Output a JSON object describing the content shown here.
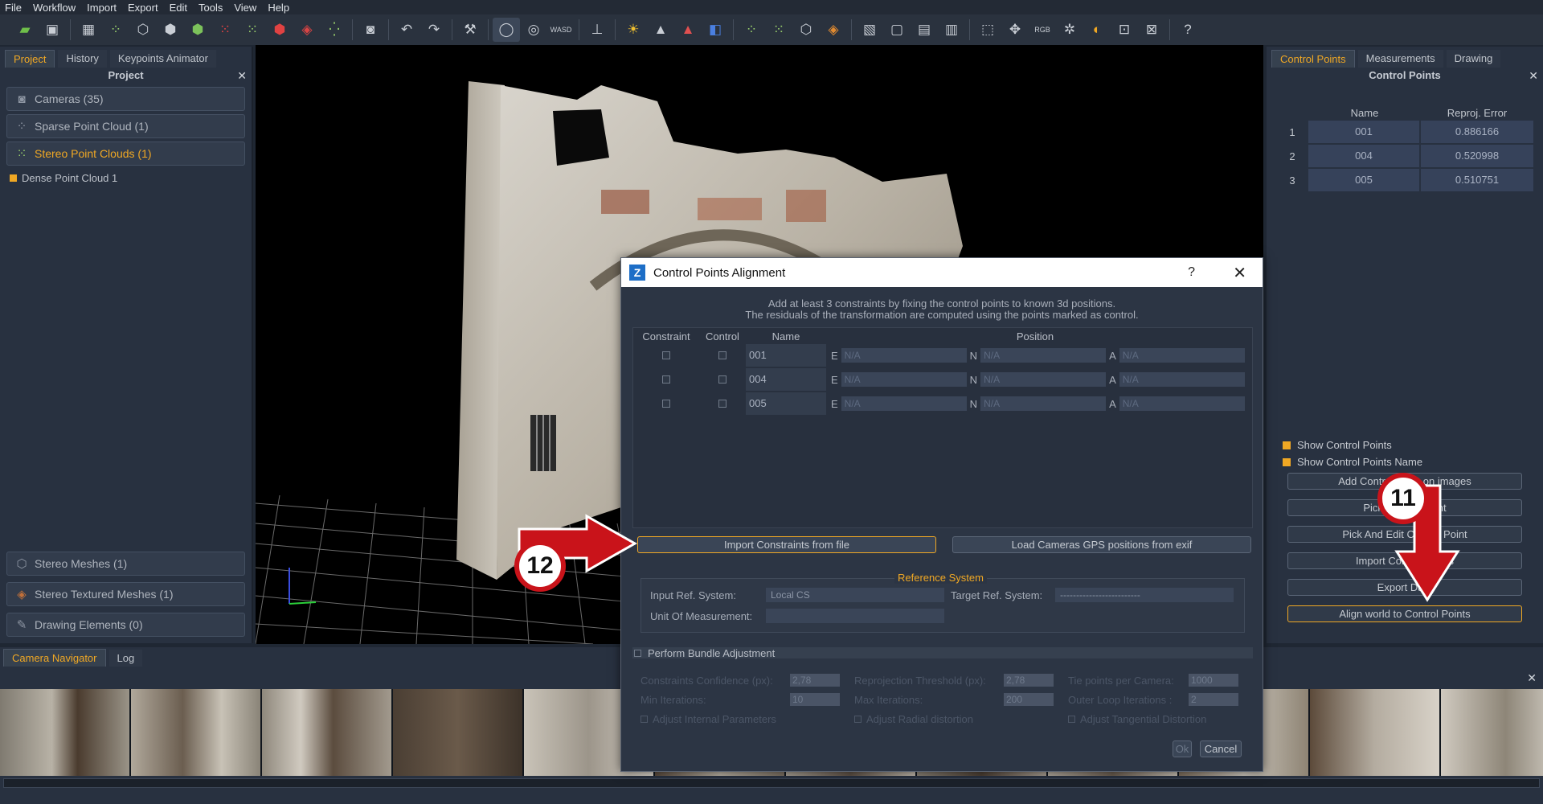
{
  "menu": [
    "File",
    "Workflow",
    "Import",
    "Export",
    "Edit",
    "Tools",
    "View",
    "Help"
  ],
  "left_panel": {
    "tabs": [
      "Project",
      "History",
      "Keypoints Animator"
    ],
    "title": "Project",
    "items_top": [
      {
        "label": "Cameras (35)",
        "icon": "camera-icon",
        "accent": false
      },
      {
        "label": "Sparse Point Cloud (1)",
        "icon": "sparse-cloud-icon",
        "accent": false
      },
      {
        "label": "Stereo Point Clouds (1)",
        "icon": "dense-cloud-icon",
        "accent": true
      }
    ],
    "child": "Dense Point Cloud 1",
    "items_bottom": [
      {
        "label": "Stereo Meshes (1)",
        "icon": "mesh-icon"
      },
      {
        "label": "Stereo Textured Meshes (1)",
        "icon": "textured-mesh-icon"
      },
      {
        "label": "Drawing Elements (0)",
        "icon": "drawing-icon"
      }
    ]
  },
  "right_panel": {
    "tabs": [
      "Control Points",
      "Measurements",
      "Drawing"
    ],
    "title": "Control Points",
    "columns": [
      "Name",
      "Reproj. Error"
    ],
    "rows": [
      {
        "idx": "1",
        "name": "001",
        "error": "0.886166"
      },
      {
        "idx": "2",
        "name": "004",
        "error": "0.520998"
      },
      {
        "idx": "3",
        "name": "005",
        "error": "0.510751"
      }
    ],
    "show_cp": "Show Control Points",
    "show_cp_name": "Show Control Points Name",
    "buttons": [
      "Add Control Point on images",
      "Pick Control Point",
      "Pick And Edit Control Point",
      "Import Control Points",
      "Export Data",
      "Align world to Control Points"
    ]
  },
  "bottom": {
    "tabs": [
      "Camera Navigator",
      "Log"
    ]
  },
  "dialog": {
    "title": "Control Points Alignment",
    "help": "?",
    "line1": "Add at least 3 constraints by fixing the control points to known 3d positions.",
    "line2": "The residuals of the transformation are computed using the points marked as control.",
    "columns": {
      "constraint": "Constraint",
      "control": "Control",
      "name": "Name",
      "position": "Position"
    },
    "rows": [
      {
        "name": "001",
        "e": "N/A",
        "n": "N/A",
        "a": "N/A"
      },
      {
        "name": "004",
        "e": "N/A",
        "n": "N/A",
        "a": "N/A"
      },
      {
        "name": "005",
        "e": "N/A",
        "n": "N/A",
        "a": "N/A"
      }
    ],
    "axis": {
      "e": "E",
      "n": "N",
      "a": "A"
    },
    "import_btn": "Import Constraints from file",
    "gps_btn": "Load Cameras GPS positions from exif",
    "ref_title": "Reference System",
    "input_ref_label": "Input Ref. System:",
    "input_ref_value": "Local CS",
    "target_ref_label": "Target Ref. System:",
    "target_ref_value": "-------------------------",
    "unit_label": "Unit Of Measurement:",
    "bundle": "Perform Bundle Adjustment",
    "params": {
      "conf_label": "Constraints Confidence (px):",
      "conf": "2,78",
      "reproj_label": "Reprojection Threshold (px):",
      "reproj": "2,78",
      "tie_label": "Tie points per Camera:",
      "tie": "1000",
      "min_label": "Min Iterations:",
      "min": "10",
      "max_label": "Max Iterations:",
      "max": "200",
      "outer_label": "Outer Loop Iterations :",
      "outer": "2",
      "adj_int": "Adjust Internal Parameters",
      "adj_rad": "Adjust Radial distortion",
      "adj_tan": "Adjust Tangential Distortion"
    },
    "ok": "Ok",
    "cancel": "Cancel"
  },
  "annotations": {
    "badge11": "11",
    "badge12": "12"
  },
  "colors": {
    "accent": "#f0a824",
    "annotation": "#c9131a"
  }
}
